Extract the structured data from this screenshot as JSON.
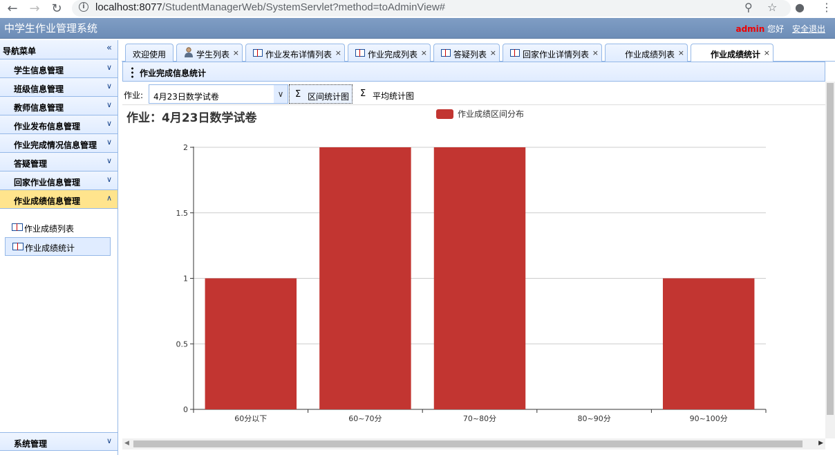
{
  "browser": {
    "url_host": "localhost:8077",
    "url_path": "/StudentManagerWeb/SystemServlet?method=toAdminView#"
  },
  "header": {
    "title": "中学生作业管理系统",
    "user": "admin",
    "greeting": " 您好",
    "logout": "安全退出"
  },
  "sidebar": {
    "title": "导航菜单",
    "sections": [
      {
        "label": "学生信息管理"
      },
      {
        "label": "班级信息管理"
      },
      {
        "label": "教师信息管理"
      },
      {
        "label": "作业发布信息管理"
      },
      {
        "label": "作业完成情况信息管理"
      },
      {
        "label": "答疑管理"
      },
      {
        "label": "回家作业信息管理"
      },
      {
        "label": "作业成绩信息管理"
      }
    ],
    "sub_items": [
      {
        "label": "作业成绩列表"
      },
      {
        "label": "作业成绩统计"
      }
    ],
    "bottom": "系统管理"
  },
  "tabs": [
    {
      "label": "欢迎使用"
    },
    {
      "label": "学生列表"
    },
    {
      "label": "作业发布详情列表"
    },
    {
      "label": "作业完成列表"
    },
    {
      "label": "答疑列表"
    },
    {
      "label": "回家作业详情列表"
    },
    {
      "label": "作业成绩列表"
    },
    {
      "label": "作业成绩统计"
    }
  ],
  "tab_close": "×",
  "panel": {
    "title": "作业完成信息统计",
    "filter_label": "作业:",
    "filter_value": "4月23日数学试卷",
    "btn_interval": "区间统计图",
    "btn_average": "平均统计图"
  },
  "chart_data": {
    "type": "bar",
    "title": "作业：4月23日数学试卷",
    "categories": [
      "60分以下",
      "60~70分",
      "70~80分",
      "80~90分",
      "90~100分"
    ],
    "series": [
      {
        "name": "作业成绩区间分布",
        "values": [
          1,
          2,
          2,
          0,
          1
        ],
        "color": "#c23531"
      }
    ],
    "ylim": [
      0,
      2
    ],
    "yticks": [
      "0",
      "0.5",
      "1",
      "1.5",
      "2"
    ],
    "grid": true,
    "legend": "top-center"
  }
}
